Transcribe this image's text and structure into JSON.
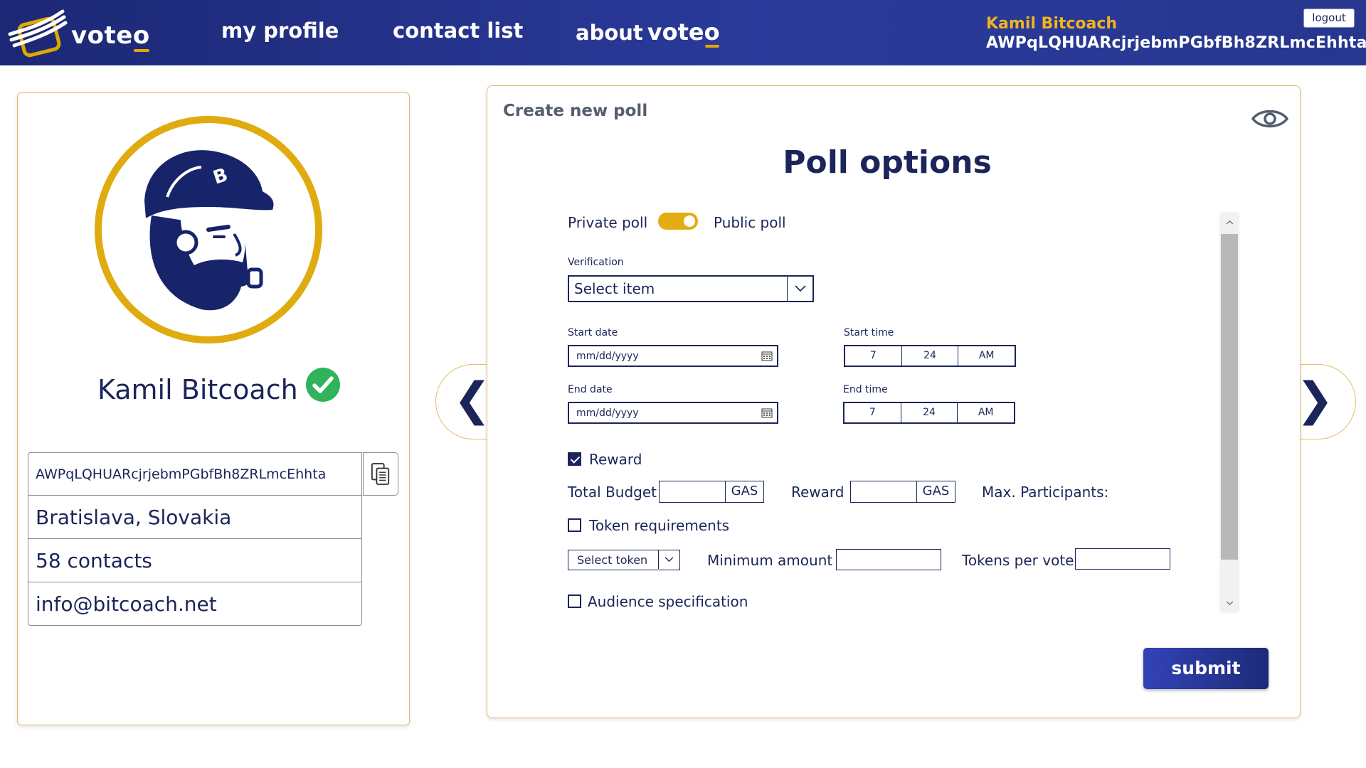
{
  "header": {
    "brand": {
      "name_prefix": "vote",
      "name_suffix": "o"
    },
    "nav": {
      "my_profile": "my profile",
      "contact_list": "contact list",
      "about_prefix": "about",
      "about_brand_prefix": "vote",
      "about_brand_suffix": "o"
    },
    "user": {
      "name": "Kamil Bitcoach",
      "address": "AWPqLQHUARcjrjebmPGbfBh8ZRLmcEhhta"
    },
    "logout_label": "logout"
  },
  "profile": {
    "name": "Kamil Bitcoach",
    "verified": true,
    "address": "AWPqLQHUARcjrjebmPGbfBh8ZRLmcEhhta",
    "location": "Bratislava, Slovakia",
    "contacts": "58 contacts",
    "email": "info@bitcoach.net",
    "avatar_icon": "bearded-man-cap-pipe-icon"
  },
  "nav_arrows": {
    "prev": "❮",
    "next": "❯"
  },
  "poll": {
    "heading": "Create new poll",
    "title": "Poll options",
    "visibility": {
      "private_label": "Private poll",
      "public_label": "Public poll",
      "is_public": true
    },
    "verification": {
      "label": "Verification",
      "selected": "Select item"
    },
    "start_date": {
      "label": "Start date",
      "placeholder": "mm/dd/yyyy"
    },
    "end_date": {
      "label": "End date",
      "placeholder": "mm/dd/yyyy"
    },
    "start_time": {
      "label": "Start time",
      "hour": "7",
      "minute": "24",
      "period": "AM"
    },
    "end_time": {
      "label": "End time",
      "hour": "7",
      "minute": "24",
      "period": "AM"
    },
    "reward": {
      "label": "Reward",
      "checked": true,
      "total_budget_label": "Total Budget",
      "total_budget_unit": "GAS",
      "reward_label": "Reward",
      "reward_unit": "GAS",
      "max_participants_label": "Max. Participants:"
    },
    "token_requirements": {
      "label": "Token requirements",
      "checked": false,
      "token_select": "Select token",
      "minimum_amount_label": "Minimum amount",
      "tokens_per_vote_label": "Tokens per vote"
    },
    "audience": {
      "label": "Audience specification",
      "checked": false
    },
    "submit_label": "submit"
  },
  "colors": {
    "primary_navy": "#1b2559",
    "header_blue": "#2a3a9a",
    "accent_gold": "#dfab0f",
    "user_name_gold": "#f0b323",
    "card_border": "#e3be6a",
    "verified_green": "#2fb35b"
  }
}
